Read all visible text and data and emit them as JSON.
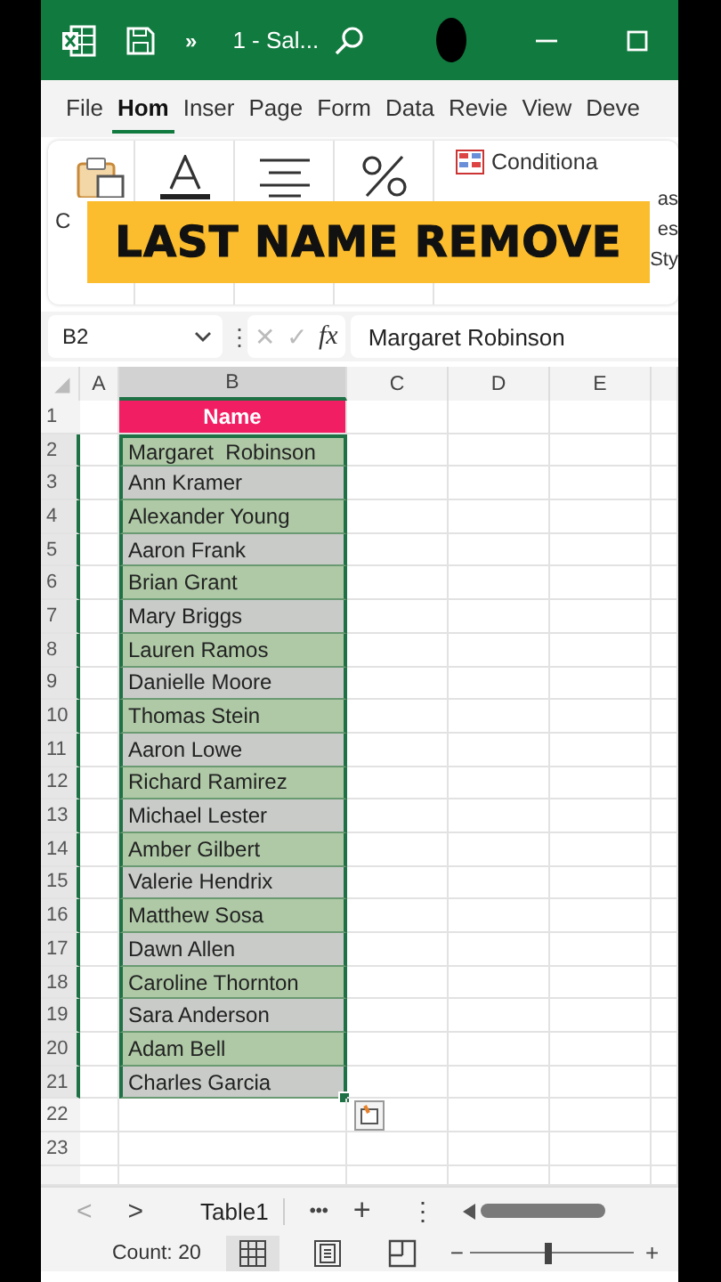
{
  "title_bar": {
    "more": "»",
    "document_title": "1 - Sal..."
  },
  "ribbon_tabs": [
    {
      "label": "File",
      "selected": false
    },
    {
      "label": "Hom",
      "selected": true
    },
    {
      "label": "Inser",
      "selected": false
    },
    {
      "label": "Page",
      "selected": false
    },
    {
      "label": "Form",
      "selected": false
    },
    {
      "label": "Data",
      "selected": false
    },
    {
      "label": "Revie",
      "selected": false
    },
    {
      "label": "View",
      "selected": false
    },
    {
      "label": "Deve",
      "selected": false
    }
  ],
  "ribbon": {
    "left_fragment": "C",
    "conditional": "Conditiona",
    "right_fragments": [
      "as",
      "es",
      "Sty"
    ]
  },
  "banner": "LAST NAME REMOVE",
  "formula_bar": {
    "name_box": "B2",
    "separator": "⋮",
    "cancel": "✕",
    "enter": "✓",
    "function_label": "fx",
    "formula": "Margaret Robinson"
  },
  "columns": [
    {
      "label": "A",
      "selected": false
    },
    {
      "label": "B",
      "selected": true
    },
    {
      "label": "C",
      "selected": false
    },
    {
      "label": "D",
      "selected": false
    },
    {
      "label": "E",
      "selected": false
    }
  ],
  "rows": [
    {
      "number": "1",
      "kind": "header",
      "value": "Name",
      "selected": false
    },
    {
      "number": "2",
      "kind": "data",
      "value": "Margaret  Robinson",
      "selected": true
    },
    {
      "number": "3",
      "kind": "data",
      "value": "Ann Kramer",
      "selected": true
    },
    {
      "number": "4",
      "kind": "data",
      "value": "Alexander Young",
      "selected": true
    },
    {
      "number": "5",
      "kind": "data",
      "value": "Aaron Frank",
      "selected": true
    },
    {
      "number": "6",
      "kind": "data",
      "value": "Brian Grant",
      "selected": true
    },
    {
      "number": "7",
      "kind": "data",
      "value": "Mary Briggs",
      "selected": true
    },
    {
      "number": "8",
      "kind": "data",
      "value": "Lauren Ramos",
      "selected": true
    },
    {
      "number": "9",
      "kind": "data",
      "value": "Danielle Moore",
      "selected": true
    },
    {
      "number": "10",
      "kind": "data",
      "value": "Thomas Stein",
      "selected": true
    },
    {
      "number": "11",
      "kind": "data",
      "value": "Aaron Lowe",
      "selected": true
    },
    {
      "number": "12",
      "kind": "data",
      "value": "Richard Ramirez",
      "selected": true
    },
    {
      "number": "13",
      "kind": "data",
      "value": "Michael Lester",
      "selected": true
    },
    {
      "number": "14",
      "kind": "data",
      "value": "Amber Gilbert",
      "selected": true
    },
    {
      "number": "15",
      "kind": "data",
      "value": "Valerie Hendrix",
      "selected": true
    },
    {
      "number": "16",
      "kind": "data",
      "value": "Matthew Sosa",
      "selected": true
    },
    {
      "number": "17",
      "kind": "data",
      "value": "Dawn Allen",
      "selected": true
    },
    {
      "number": "18",
      "kind": "data",
      "value": "Caroline Thornton",
      "selected": true
    },
    {
      "number": "19",
      "kind": "data",
      "value": "Sara Anderson",
      "selected": true
    },
    {
      "number": "20",
      "kind": "data",
      "value": "Adam Bell",
      "selected": true
    },
    {
      "number": "21",
      "kind": "data",
      "value": "Charles Garcia",
      "selected": true
    },
    {
      "number": "22",
      "kind": "empty",
      "selected": false
    },
    {
      "number": "23",
      "kind": "empty",
      "selected": false
    }
  ],
  "sheet_bar": {
    "prev": "<",
    "next": ">",
    "tabs": [
      {
        "label": "Table1",
        "selected": true
      }
    ],
    "more": "•••",
    "add": "+",
    "menu": "⋮"
  },
  "status_bar": {
    "count": "Count: 20",
    "views": [
      {
        "kind": "normal",
        "selected": true
      },
      {
        "kind": "page_layout",
        "selected": false
      },
      {
        "kind": "page_break",
        "selected": false
      }
    ],
    "zoom_out": "−",
    "zoom_in": "+",
    "zoom": {
      "level": 0.47
    }
  }
}
